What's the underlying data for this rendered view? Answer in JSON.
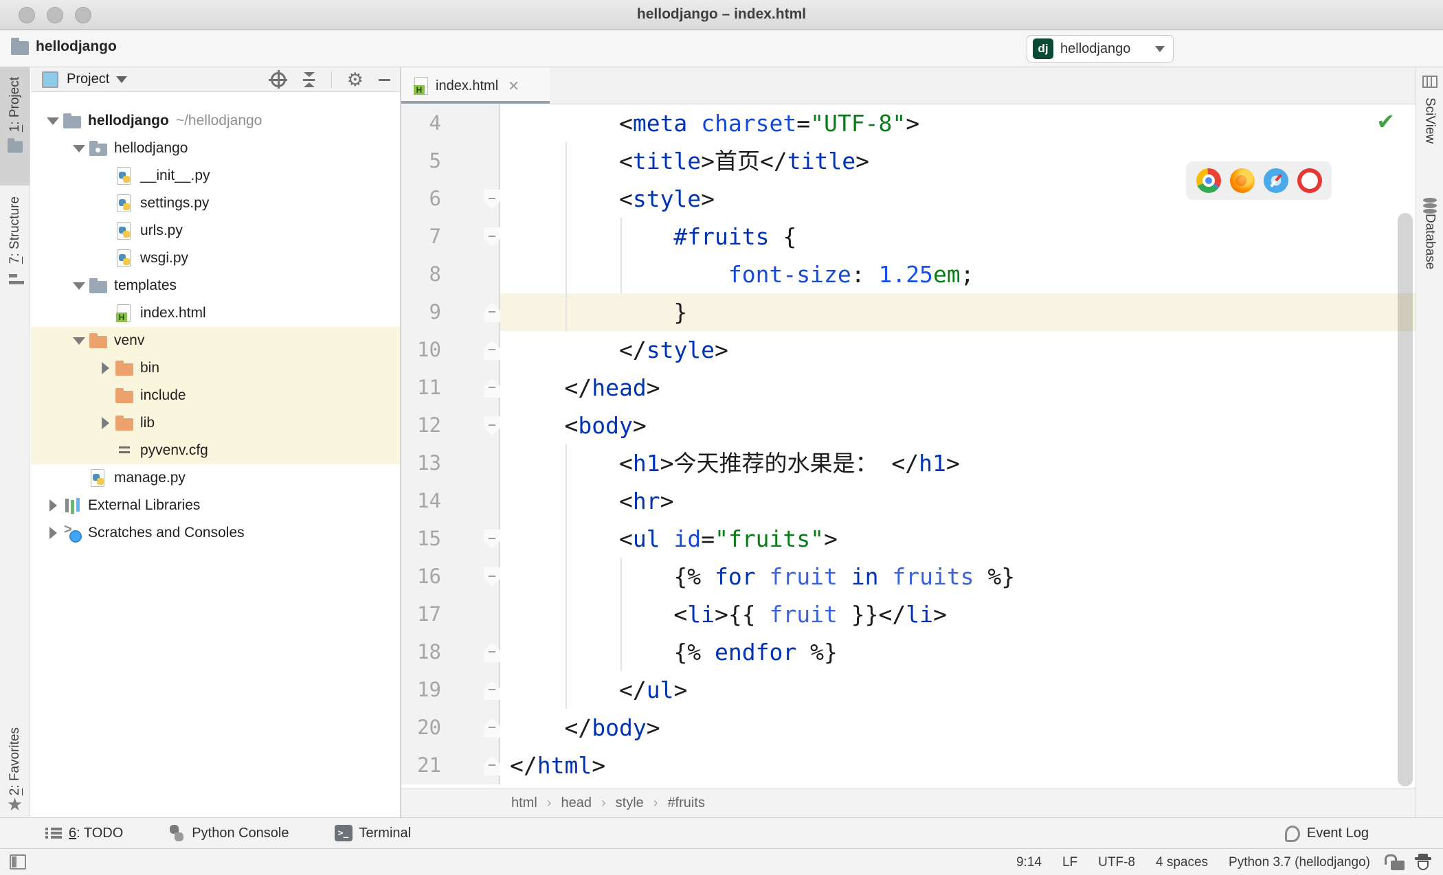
{
  "colors": {
    "tag": "#0033B3",
    "attr": "#174AD4",
    "string": "#067D17",
    "number": "#1750EB",
    "variable": "#3B64D8",
    "caret_line": "#F8F4E3",
    "selection": "#FAF6DE",
    "run_green": "#59A869",
    "django_badge": "#0C4B33"
  },
  "window": {
    "title": "hellodjango – index.html"
  },
  "toolbar": {
    "project": "hellodjango",
    "run_config": "hellodjango"
  },
  "left_stripe": {
    "items": [
      "1: Project",
      "7: Structure",
      "2: Favorites"
    ]
  },
  "right_stripe": {
    "items": [
      "SciView",
      "Database"
    ]
  },
  "project_panel": {
    "title": "Project",
    "tree": [
      {
        "label": "hellodjango",
        "path": "~/hellodjango",
        "icon": "folder",
        "arrow": "down",
        "level": 0,
        "bold": true
      },
      {
        "label": "hellodjango",
        "icon": "package-folder",
        "arrow": "down",
        "level": 1
      },
      {
        "label": "__init__.py",
        "icon": "python-file",
        "level": 2
      },
      {
        "label": "settings.py",
        "icon": "python-file",
        "level": 2
      },
      {
        "label": "urls.py",
        "icon": "python-file",
        "level": 2
      },
      {
        "label": "wsgi.py",
        "icon": "python-file",
        "level": 2
      },
      {
        "label": "templates",
        "icon": "folder",
        "arrow": "down",
        "level": 1
      },
      {
        "label": "index.html",
        "icon": "html-file",
        "level": 2
      },
      {
        "label": "venv",
        "icon": "excluded-folder",
        "arrow": "down",
        "level": 1,
        "hl": true
      },
      {
        "label": "bin",
        "icon": "excluded-folder",
        "arrow": "right",
        "level": 2,
        "hl": true
      },
      {
        "label": "include",
        "icon": "excluded-folder",
        "level": 2,
        "hl": true
      },
      {
        "label": "lib",
        "icon": "excluded-folder",
        "arrow": "right",
        "level": 2,
        "hl": true
      },
      {
        "label": "pyvenv.cfg",
        "icon": "config-file",
        "level": 2,
        "hl": true
      },
      {
        "label": "manage.py",
        "icon": "python-file",
        "level": 1
      },
      {
        "label": "External Libraries",
        "icon": "libraries",
        "arrow": "right",
        "level": 0
      },
      {
        "label": "Scratches and Consoles",
        "icon": "scratches",
        "arrow": "right",
        "level": 0
      }
    ]
  },
  "editor": {
    "tab": "index.html",
    "breadcrumbs": [
      "html",
      "head",
      "style",
      "#fruits"
    ],
    "lines": [
      {
        "n": 4,
        "i": 8,
        "f": "",
        "segs": [
          [
            "p",
            "<"
          ],
          [
            "t",
            "meta"
          ],
          [
            "p",
            " "
          ],
          [
            "a",
            "charset"
          ],
          [
            "p",
            "="
          ],
          [
            "s",
            "\"UTF-8\""
          ],
          [
            "p",
            ">"
          ]
        ]
      },
      {
        "n": 5,
        "i": 8,
        "f": "",
        "segs": [
          [
            "p",
            "<"
          ],
          [
            "t",
            "title"
          ],
          [
            "p",
            ">"
          ],
          [
            "p",
            "首页"
          ],
          [
            "p",
            "</"
          ],
          [
            "t",
            "title"
          ],
          [
            "p",
            ">"
          ]
        ]
      },
      {
        "n": 6,
        "i": 8,
        "f": "d",
        "segs": [
          [
            "p",
            "<"
          ],
          [
            "t",
            "style"
          ],
          [
            "p",
            ">"
          ]
        ]
      },
      {
        "n": 7,
        "i": 12,
        "f": "d",
        "segs": [
          [
            "t",
            "#fruits"
          ],
          [
            "p",
            " {"
          ]
        ]
      },
      {
        "n": 8,
        "i": 16,
        "f": "",
        "segs": [
          [
            "a",
            "font-size"
          ],
          [
            "p",
            ": "
          ],
          [
            "n",
            "1.25"
          ],
          [
            "s",
            "em"
          ],
          [
            "p",
            ";"
          ]
        ]
      },
      {
        "n": 9,
        "i": 12,
        "f": "u",
        "caret": true,
        "segs": [
          [
            "p",
            "}"
          ]
        ]
      },
      {
        "n": 10,
        "i": 8,
        "f": "u",
        "segs": [
          [
            "p",
            "</"
          ],
          [
            "t",
            "style"
          ],
          [
            "p",
            ">"
          ]
        ]
      },
      {
        "n": 11,
        "i": 4,
        "f": "u",
        "segs": [
          [
            "p",
            "</"
          ],
          [
            "t",
            "head"
          ],
          [
            "p",
            ">"
          ]
        ]
      },
      {
        "n": 12,
        "i": 4,
        "f": "d",
        "segs": [
          [
            "p",
            "<"
          ],
          [
            "t",
            "body"
          ],
          [
            "p",
            ">"
          ]
        ]
      },
      {
        "n": 13,
        "i": 8,
        "f": "",
        "segs": [
          [
            "p",
            "<"
          ],
          [
            "t",
            "h1"
          ],
          [
            "p",
            ">"
          ],
          [
            "p",
            "今天推荐的水果是： "
          ],
          [
            "p",
            "</"
          ],
          [
            "t",
            "h1"
          ],
          [
            "p",
            ">"
          ]
        ]
      },
      {
        "n": 14,
        "i": 8,
        "f": "",
        "segs": [
          [
            "p",
            "<"
          ],
          [
            "t",
            "hr"
          ],
          [
            "p",
            ">"
          ]
        ]
      },
      {
        "n": 15,
        "i": 8,
        "f": "d",
        "segs": [
          [
            "p",
            "<"
          ],
          [
            "t",
            "ul"
          ],
          [
            "p",
            " "
          ],
          [
            "a",
            "id"
          ],
          [
            "p",
            "="
          ],
          [
            "s",
            "\"fruits\""
          ],
          [
            "p",
            ">"
          ]
        ]
      },
      {
        "n": 16,
        "i": 12,
        "f": "d",
        "segs": [
          [
            "p",
            "{% "
          ],
          [
            "t",
            "for"
          ],
          [
            "v",
            " fruit "
          ],
          [
            "t",
            "in"
          ],
          [
            "v",
            " fruits"
          ],
          [
            "p",
            " %}"
          ]
        ]
      },
      {
        "n": 17,
        "i": 12,
        "f": "",
        "segs": [
          [
            "p",
            "<"
          ],
          [
            "t",
            "li"
          ],
          [
            "p",
            ">{{ "
          ],
          [
            "v",
            "fruit"
          ],
          [
            "p",
            " }}</"
          ],
          [
            "t",
            "li"
          ],
          [
            "p",
            ">"
          ]
        ]
      },
      {
        "n": 18,
        "i": 12,
        "f": "u",
        "segs": [
          [
            "p",
            "{% "
          ],
          [
            "t",
            "endfor"
          ],
          [
            "p",
            " %}"
          ]
        ]
      },
      {
        "n": 19,
        "i": 8,
        "f": "u",
        "segs": [
          [
            "p",
            "</"
          ],
          [
            "t",
            "ul"
          ],
          [
            "p",
            ">"
          ]
        ]
      },
      {
        "n": 20,
        "i": 4,
        "f": "u",
        "segs": [
          [
            "p",
            "</"
          ],
          [
            "t",
            "body"
          ],
          [
            "p",
            ">"
          ]
        ]
      },
      {
        "n": 21,
        "i": 0,
        "f": "u",
        "segs": [
          [
            "p",
            "</"
          ],
          [
            "t",
            "html"
          ],
          [
            "p",
            ">"
          ]
        ]
      }
    ]
  },
  "bottom_bar": {
    "items": [
      "6: TODO",
      "Python Console",
      "Terminal"
    ],
    "event_log": "Event Log"
  },
  "status_bar": {
    "caret": "9:14",
    "line_separator": "LF",
    "encoding": "UTF-8",
    "indent": "4 spaces",
    "interpreter": "Python 3.7 (hellodjango)"
  }
}
